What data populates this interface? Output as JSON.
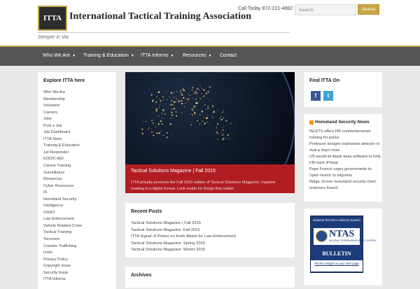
{
  "header": {
    "logo_mark": "ITTA",
    "title": "International Tactical Training Association",
    "tagline": "Semper in Via",
    "call_text": "Call Today 872-221-4882",
    "search_placeholder": "Search",
    "search_button": "Search",
    "accent_color": "#c9a94e"
  },
  "nav": {
    "background": "#555555",
    "items": [
      {
        "label": "Who We Are",
        "has_dropdown": true
      },
      {
        "label": "Training & Education",
        "has_dropdown": true
      },
      {
        "label": "ITTA Informs",
        "has_dropdown": true
      },
      {
        "label": "Resources",
        "has_dropdown": true
      },
      {
        "label": "Contact",
        "has_dropdown": false
      }
    ]
  },
  "explore": {
    "title": "Explore ITTA here",
    "links": [
      "Who We Are",
      "Membership",
      "Volunteer",
      "Careers",
      "Jobs",
      "Post a Job",
      "Job Dashboard",
      "ITTA Store",
      "Training & Education",
      "1st Responder",
      "EOD/C-IED",
      "Canine Training",
      "Surveillance",
      "Resources",
      "Cyber Resources",
      "IA",
      "Homeland Security",
      "Intelligence",
      "OSINT",
      "Law Enforcement",
      "Vehicle Related Crime",
      "Tactical Training",
      "Terrorism",
      "Counter-Trafficking",
      "Links",
      "Privacy Policy",
      "Copyright Issue",
      "Security Issue",
      "ITTA Informs"
    ]
  },
  "feature": {
    "title": "Tactical Solutions Magazine | Fall 2015",
    "excerpt": "ITTA proudly presents the Fall 2015 edition of Tactical Solutions Magazine. Inspired reading in a digital format. Look inside for things that matter.",
    "caption_color": "#b01e23"
  },
  "recent_posts": {
    "title": "Recent Posts",
    "items": [
      "Tactical Solutions Magazine | Fall 2015",
      "Tactical Solutions Magazine: Fall 2015",
      "ITTA Signal: A Primer on Knife Attack for Law Enforcement",
      "Tactical Solutions Magazine: Spring 2015",
      "Tactical Solutions Magazine: Winter 2015"
    ]
  },
  "archives": {
    "title": "Archives"
  },
  "find": {
    "title": "Find ITTA On",
    "icons": [
      "facebook-icon",
      "twitter-icon"
    ]
  },
  "homeland": {
    "title": "Homeland Security News",
    "items": [
      "INLETS offers FBI counterterrorism training for police",
      "Professor designs explosives detector to rival a dog's nose",
      "US would let Apple keep software to help FBI hack iPhone",
      "Pope Francis urges governments to 'open hearts' to migrants",
      "Ridge, former homeland security chief, endorses Kasich"
    ]
  },
  "ntas": {
    "top_text": "National Terrorism Advisory System",
    "logo_word": "NTAS",
    "logo_sub": "NATIONAL TERRORISM ADVISORY SYSTEM",
    "bulletin": "BULLETIN",
    "link_text": "Put this widget on your web page"
  }
}
